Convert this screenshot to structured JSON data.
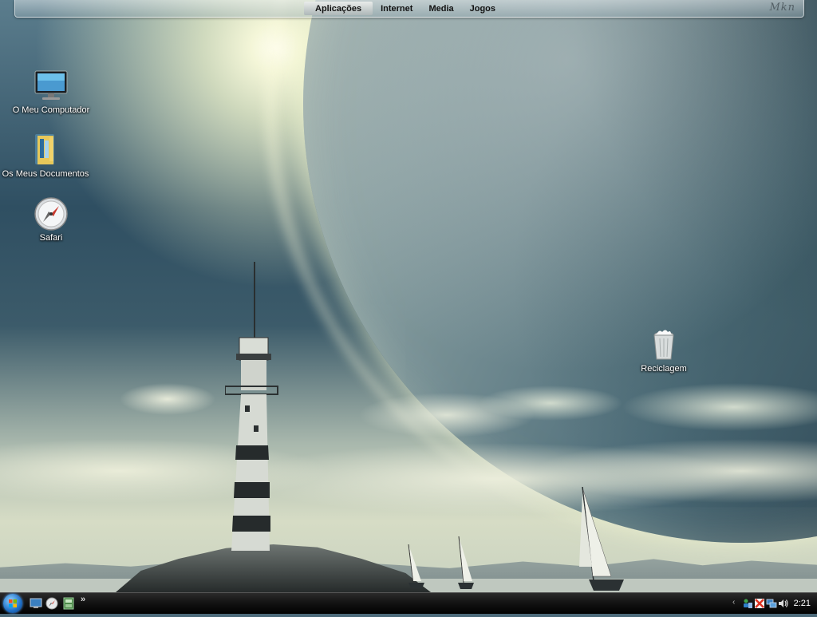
{
  "top_menu": {
    "items": [
      "Aplicações",
      "Internet",
      "Media",
      "Jogos"
    ],
    "active_index": 0,
    "signature": "Mkn"
  },
  "desktop_icons": {
    "computer": {
      "label": "O Meu Computador",
      "icon": "computer-icon"
    },
    "documents": {
      "label": "Os Meus Documentos",
      "icon": "documents-folder-icon"
    },
    "safari": {
      "label": "Safari",
      "icon": "safari-compass-icon"
    },
    "recycle": {
      "label": "Reciclagem",
      "icon": "recycle-bin-icon"
    }
  },
  "taskbar": {
    "start_icon": "windows-orb-icon",
    "quick_launch": [
      "show-desktop-icon",
      "safari-compass-icon",
      "window-switcher-icon"
    ],
    "overflow": "»",
    "tray": {
      "expand": "‹",
      "icons": [
        "user-network-icon",
        "security-alert-icon",
        "network-icon",
        "volume-icon"
      ],
      "time": "2:21"
    }
  },
  "colors": {
    "taskbar": "#141414",
    "start_orb": "#1f6fc6",
    "menu_text": "#111111",
    "icon_label": "#ffffff"
  }
}
